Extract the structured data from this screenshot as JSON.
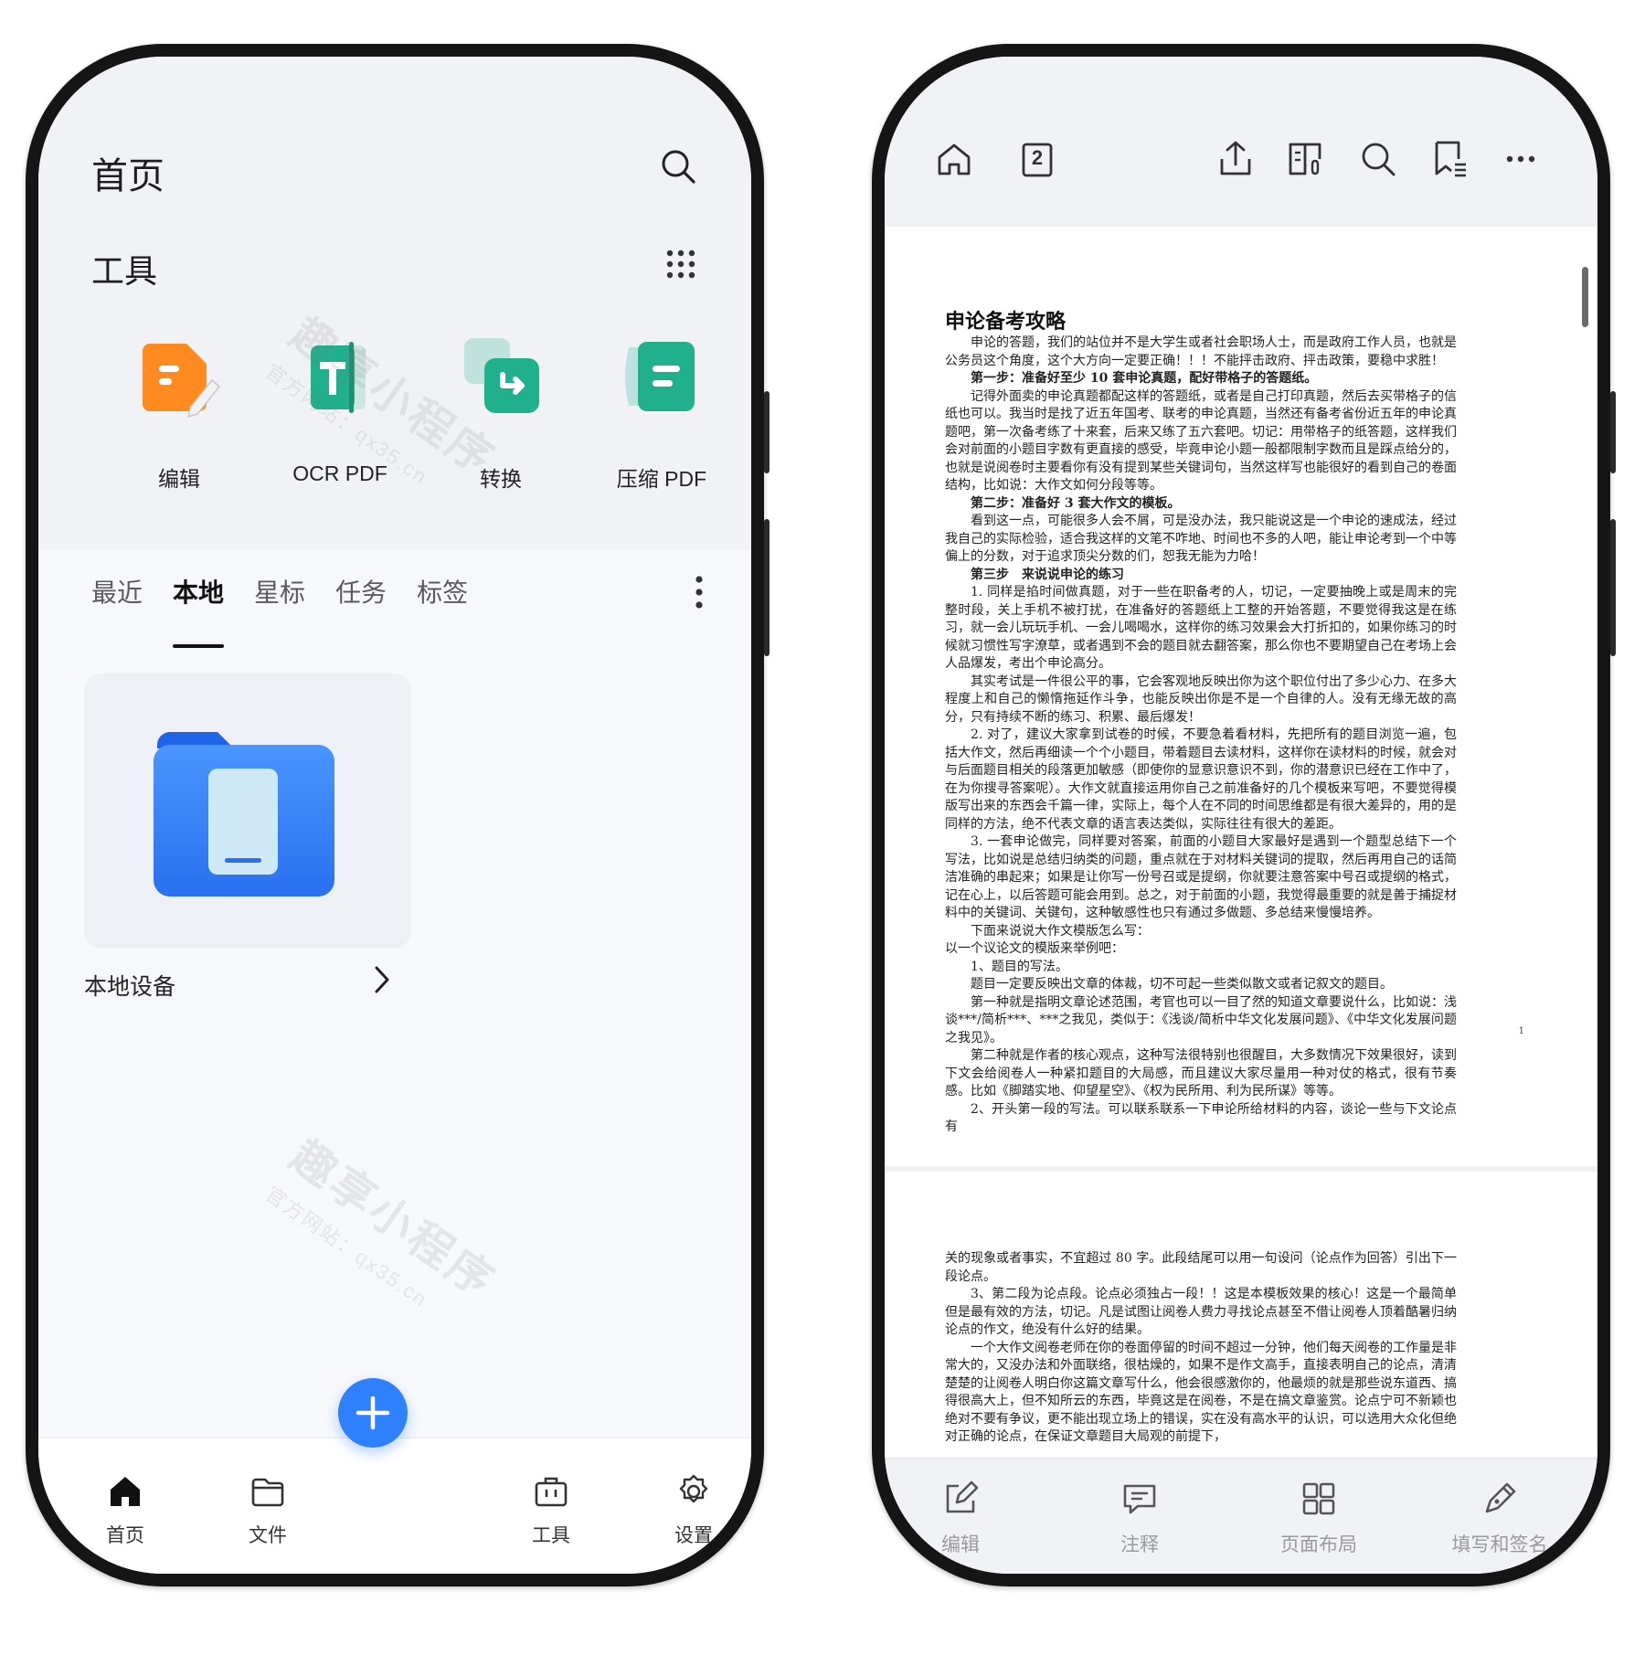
{
  "left_phone": {
    "page_title": "首页",
    "section_title": "工具",
    "tools": [
      {
        "label": "编辑",
        "icon": "edit-document-icon",
        "color": "#ff8a1f"
      },
      {
        "label": "OCR PDF",
        "icon": "ocr-icon",
        "color": "#20b08c"
      },
      {
        "label": "转换",
        "icon": "convert-icon",
        "color": "#20b08c"
      },
      {
        "label": "压缩 PDF",
        "icon": "compress-icon",
        "color": "#20b08c"
      }
    ],
    "tabs": [
      "最近",
      "本地",
      "星标",
      "任务",
      "标签"
    ],
    "active_tab": "本地",
    "folder": {
      "label": "本地设备",
      "icon": "local-device-folder-icon",
      "color": "#2f80ff"
    },
    "nav": [
      {
        "label": "首页",
        "icon": "home-icon"
      },
      {
        "label": "文件",
        "icon": "folder-icon"
      },
      {
        "label": "",
        "icon": "add-icon"
      },
      {
        "label": "工具",
        "icon": "toolbox-icon"
      },
      {
        "label": "设置",
        "icon": "gear-icon"
      }
    ],
    "watermark": {
      "text": "趣享小程序",
      "sub": "官方网站：qx35.cn"
    }
  },
  "right_phone": {
    "toolbar": {
      "page_count_badge": "2",
      "icons": [
        "home-icon",
        "pages-icon",
        "share-icon",
        "reader-mode-icon",
        "search-icon",
        "bookmark-list-icon",
        "more-icon"
      ]
    },
    "document": {
      "title": "申论备考攻略",
      "paragraphs": [
        {
          "style": "ind",
          "text": "申论的答题，我们的站位并不是大学生或者社会职场人士，而是政府工作人员，也就是公务员这个角度，这个大方向一定要正确！！！不能抨击政府、抨击政策，要稳中求胜！"
        },
        {
          "style": "ind b",
          "text": "第一步：准备好至少 10 套申论真题，配好带格子的答题纸。"
        },
        {
          "style": "ind",
          "text": "记得外面卖的申论真题都配这样的答题纸，或者是自己打印真题，然后去买带格子的信纸也可以。我当时是找了近五年国考、联考的申论真题，当然还有备考省份近五年的申论真题吧，第一次备考练了十来套，后来又练了五六套吧。切记：用带格子的纸答题，这样我们会对前面的小题目字数有更直接的感受，毕竟申论小题一般都限制字数而且是踩点给分的，也就是说阅卷时主要看你有没有提到某些关键词句，当然这样写也能很好的看到自己的卷面结构，比如说：大作文如何分段等等。"
        },
        {
          "style": "ind b",
          "text": "第二步：准备好 3 套大作文的模板。"
        },
        {
          "style": "ind",
          "text": "看到这一点，可能很多人会不屑，可是没办法，我只能说这是一个申论的速成法，经过我自己的实际检验，适合我这样的文笔不咋地、时间也不多的人吧，能让申论考到一个中等偏上的分数，对于追求顶尖分数的们，恕我无能为力哈！"
        },
        {
          "style": "ind b",
          "text": "第三步　来说说申论的练习"
        },
        {
          "style": "ind",
          "text": "1. 同样是掐时间做真题，对于一些在职备考的人，切记，一定要抽晚上或是周末的完整时段，关上手机不被打扰，在准备好的答题纸上工整的开始答题，不要觉得我这是在练习，就一会儿玩玩手机、一会儿喝喝水，这样你的练习效果会大打折扣的，如果你练习的时候就习惯性写字潦草，或者遇到不会的题目就去翻答案，那么你也不要期望自己在考场上会人品爆发，考出个申论高分。"
        },
        {
          "style": "ind",
          "text": "其实考试是一件很公平的事，它会客观地反映出你为这个职位付出了多少心力、在多大程度上和自己的懒惰拖延作斗争，也能反映出你是不是一个自律的人。没有无缘无故的高分，只有持续不断的练习、积累、最后爆发！"
        },
        {
          "style": "ind",
          "text": "2. 对了，建议大家拿到试卷的时候，不要急着看材料，先把所有的题目浏览一遍，包括大作文，然后再细读一个个小题目，带着题目去读材料，这样你在读材料的时候，就会对与后面题目相关的段落更加敏感（即使你的显意识意识不到，你的潜意识已经在工作中了，在为你搜寻答案呢）。大作文就直接运用你自己之前准备好的几个模板来写吧，不要觉得模版写出来的东西会千篇一律，实际上，每个人在不同的时间思维都是有很大差异的，用的是同样的方法，绝不代表文章的语言表达类似，实际往往有很大的差距。"
        },
        {
          "style": "ind",
          "text": "3. 一套申论做完，同样要对答案，前面的小题目大家最好是遇到一个题型总结下一个写法，比如说是总结归纳类的问题，重点就在于对材料关键词的提取，然后再用自己的话简洁准确的串起来；如果是让你写一份号召或是提纲，你就要注意答案中号召或提纲的格式，记在心上，以后答题可能会用到。总之，对于前面的小题，我觉得最重要的就是善于捕捉材料中的关键词、关键句，这种敏感性也只有通过多做题、多总结来慢慢培养。"
        },
        {
          "style": "ind",
          "text": "下面来说说大作文模版怎么写："
        },
        {
          "style": "",
          "text": "以一个议论文的模版来举例吧："
        },
        {
          "style": "",
          "text": " "
        },
        {
          "style": "ind",
          "text": "1、题目的写法。"
        },
        {
          "style": "ind",
          "text": "题目一定要反映出文章的体裁，切不可起一些类似散文或者记叙文的题目。"
        },
        {
          "style": "ind",
          "text": "第一种就是指明文章论述范围，考官也可以一目了然的知道文章要说什么，比如说：浅谈***/简析***、***之我见，类似于：《浅谈/简析中华文化发展问题》、《中华文化发展问题之我见》。"
        },
        {
          "style": "ind",
          "text": "第二种就是作者的核心观点，这种写法很特别也很醒目，大多数情况下效果很好，读到下文会给阅卷人一种紧扣题目的大局感，而且建议大家尽量用一种对仗的格式，很有节奏感。比如《脚踏实地、仰望星空》、《权为民所用、利为民所谋》等等。"
        },
        {
          "style": "ind",
          "text": "2、开头第一段的写法。可以联系联系一下申论所给材料的内容，谈论一些与下文论点有"
        }
      ],
      "page_number": "1",
      "page2_paragraphs": [
        {
          "style": "",
          "text": "关的现象或者事实，不宜超过 80 字。此段结尾可以用一句设问（论点作为回答）引出下一段论点。"
        },
        {
          "style": "ind",
          "text": "3、第二段为论点段。论点必须独占一段！！这是本模板效果的核心！这是一个最简单但是最有效的方法，切记。凡是试图让阅卷人费力寻找论点甚至不借让阅卷人顶着酷暑归纳论点的作文，绝没有什么好的结果。"
        },
        {
          "style": "ind",
          "text": "一个大作文阅卷老师在你的卷面停留的时间不超过一分钟，他们每天阅卷的工作量是非常大的，又没办法和外面联络，很枯燥的，如果不是作文高手，直接表明自己的论点，清清楚楚的让阅卷人明白你这篇文章写什么，他会很感激你的，他最烦的就是那些说东道西、搞得很高大上，但不知所云的东西，毕竟这是在阅卷，不是在搞文章鉴赏。论点宁可不新颖也绝对不要有争议，更不能出现立场上的错误，实在没有高水平的认识，可以选用大众化但绝对正确的论点，在保证文章题目大局观的前提下，"
        }
      ]
    },
    "bottom_nav": [
      {
        "label": "编辑",
        "icon": "edit-icon"
      },
      {
        "label": "注释",
        "icon": "comment-icon"
      },
      {
        "label": "页面布局",
        "icon": "page-layout-icon"
      },
      {
        "label": "填写和签名",
        "icon": "sign-pen-icon"
      }
    ]
  }
}
